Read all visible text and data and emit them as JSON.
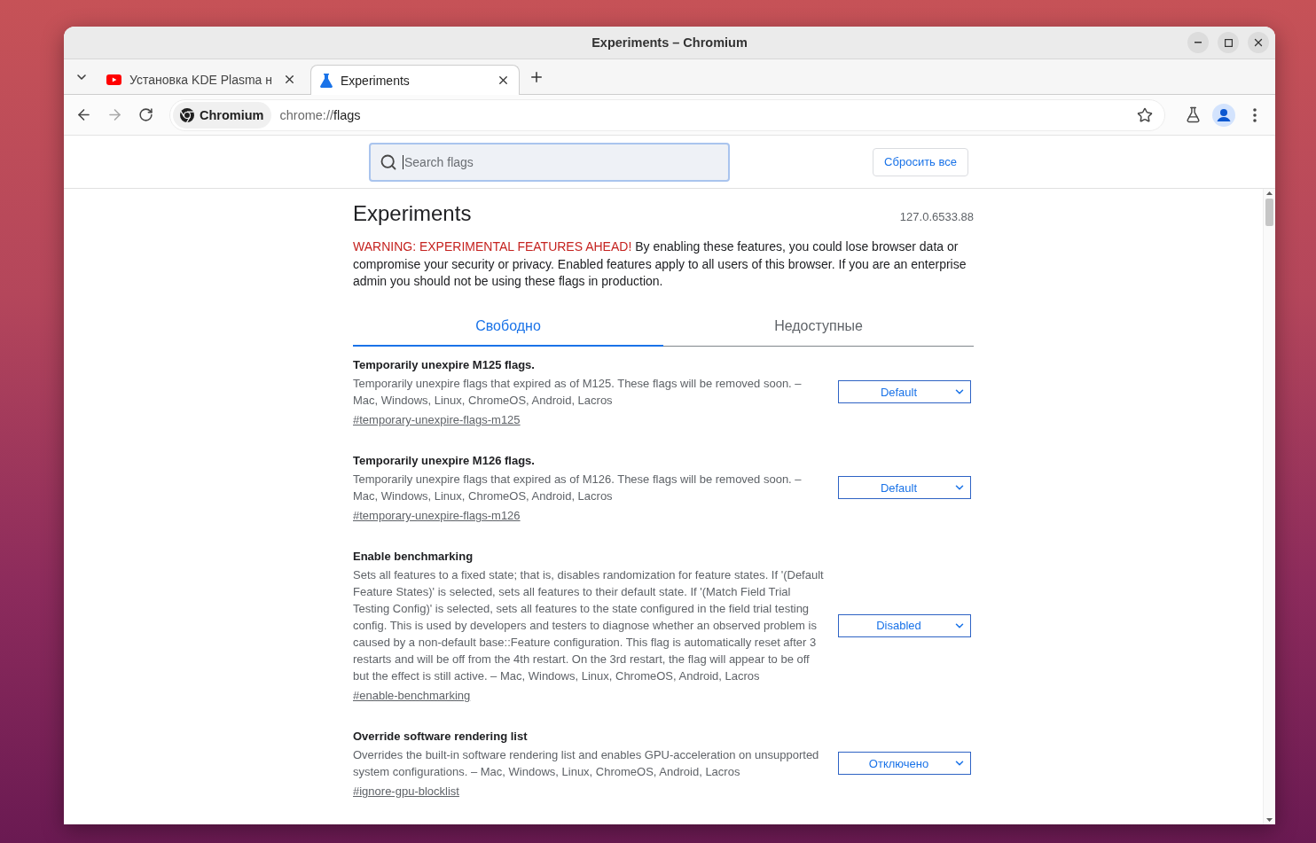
{
  "window": {
    "title": "Experiments – Chromium"
  },
  "browser_tabs": [
    {
      "title": "Установка KDE Plasma н",
      "selected": false
    },
    {
      "title": "Experiments",
      "selected": true
    }
  ],
  "address_bar": {
    "site_chip": "Chromium",
    "url_scheme": "chrome://",
    "url_path": "flags"
  },
  "header": {
    "search": {
      "placeholder": "Search flags"
    },
    "reset_button": "Сбросить все"
  },
  "page": {
    "title": "Experiments",
    "version": "127.0.6533.88",
    "warning": {
      "alert": "WARNING: EXPERIMENTAL FEATURES AHEAD!",
      "text": "By enabling these features, you could lose browser data or compromise your security or privacy. Enabled features apply to all users of this browser. If you are an enterprise admin you should not be using these flags in production."
    }
  },
  "tabs": [
    {
      "label": "Свободно",
      "selected": true
    },
    {
      "label": "Недоступные",
      "selected": false
    }
  ],
  "flags": [
    {
      "title": "Temporarily unexpire M125 flags.",
      "description": "Temporarily unexpire flags that expired as of M125. These flags will be removed soon. – Mac, Windows, Linux, ChromeOS, Android, Lacros",
      "link": "#temporary-unexpire-flags-m125",
      "value": "Default"
    },
    {
      "title": "Temporarily unexpire M126 flags.",
      "description": "Temporarily unexpire flags that expired as of M126. These flags will be removed soon. – Mac, Windows, Linux, ChromeOS, Android, Lacros",
      "link": "#temporary-unexpire-flags-m126",
      "value": "Default"
    },
    {
      "title": "Enable benchmarking",
      "description": "Sets all features to a fixed state; that is, disables randomization for feature states. If '(Default Feature States)' is selected, sets all features to their default state. If '(Match Field Trial Testing Config)' is selected, sets all features to the state configured in the field trial testing config. This is used by developers and testers to diagnose whether an observed problem is caused by a non-default base::Feature configuration. This flag is automatically reset after 3 restarts and will be off from the 4th restart. On the 3rd restart, the flag will appear to be off but the effect is still active. – Mac, Windows, Linux, ChromeOS, Android, Lacros",
      "link": "#enable-benchmarking",
      "value": "Disabled"
    },
    {
      "title": "Override software rendering list",
      "description": "Overrides the built-in software rendering list and enables GPU-acceleration on unsupported system configurations. – Mac, Windows, Linux, ChromeOS, Android, Lacros",
      "link": "#ignore-gpu-blocklist",
      "value": "Отключено"
    }
  ]
}
